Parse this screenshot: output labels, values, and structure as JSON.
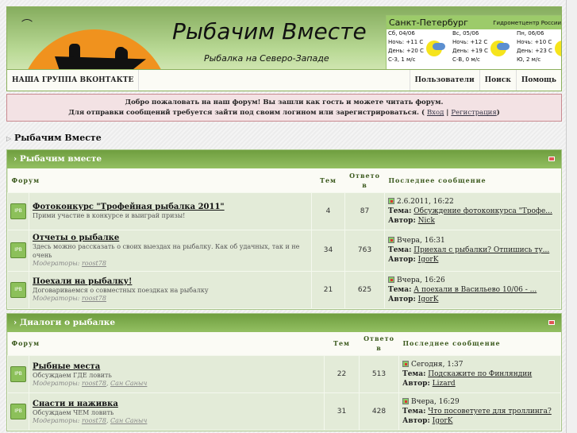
{
  "header": {
    "title": "Рыбачим Вместе",
    "subtitle": "Рыбалка на Северо-Западе"
  },
  "weather": {
    "city": "Санкт-Петербург",
    "source": "Гидрометцентр России",
    "days": [
      {
        "date": "Сб, 04/06",
        "night": "Ночь: +11 С",
        "day": "День: +20 С",
        "wind": "С-З, 1 м/с"
      },
      {
        "date": "Вс, 05/06",
        "night": "Ночь: +12 С",
        "day": "День: +19 С",
        "wind": "С-В, 0 м/с"
      },
      {
        "date": "Пн, 06/06",
        "night": "Ночь: +10 С",
        "day": "День: +23 С",
        "wind": "Ю, 2 м/с"
      }
    ]
  },
  "nav": {
    "vk": "НАША ГРУППА ВКОНТАКТЕ",
    "users": "Пользователи",
    "search": "Поиск",
    "help": "Помощь"
  },
  "welcome": {
    "line1": "Добро пожаловать на наш форум! Вы зашли как гость и можете читать форум.",
    "line2": "Для отправки сообщений требуется зайти под своим логином или зарегистрироваться. (",
    "login": "Вход",
    "register": "Регистрация",
    "close": ")"
  },
  "breadcrumb": "Рыбачим Вместе",
  "cols": {
    "forum": "Форум",
    "topics": "Тем",
    "replies": "Ответов",
    "last": "Последнее сообщение",
    "topic_label": "Тема:",
    "author_label": "Автор:",
    "mods_label": "Модераторы:"
  },
  "categories": [
    {
      "title": "Рыбачим вместе",
      "forums": [
        {
          "name": "Фотоконкурс \"Трофейная рыбалка 2011\"",
          "desc": "Прими участие в конкурсе и выиграй призы!",
          "mods": [],
          "topics": "4",
          "replies": "87",
          "last_date": "2.6.2011, 16:22",
          "last_topic": "Обсуждение фотоконкурса \"Трофе...",
          "last_author": "Nick"
        },
        {
          "name": "Отчеты о рыбалке",
          "desc": "Здесь можно рассказать о своих выездах на рыбалку. Как об удачных, так и не очень",
          "mods": [
            "roost78"
          ],
          "topics": "34",
          "replies": "763",
          "last_date": "Вчера, 16:31",
          "last_topic": "Приехал с рыбалки? Отпишись ту...",
          "last_author": "IgorK"
        },
        {
          "name": "Поехали на рыбалку!",
          "desc": "Договариваемся о совместных поездках на рыбалку",
          "mods": [
            "roost78"
          ],
          "topics": "21",
          "replies": "625",
          "last_date": "Вчера, 16:26",
          "last_topic": "А поехали в Васильево 10/06 - ...",
          "last_author": "IgorK"
        }
      ]
    },
    {
      "title": "Диалоги о рыбалке",
      "forums": [
        {
          "name": "Рыбные места",
          "desc": "Обсуждаем ГДЕ ловить",
          "mods": [
            "roost78",
            "Сан Саныч"
          ],
          "topics": "22",
          "replies": "513",
          "last_date": "Сегодня, 1:37",
          "last_topic": "Подскажите по Финляндии",
          "last_author": "Lizard"
        },
        {
          "name": "Снасти и наживка",
          "desc": "Обсуждаем ЧЕМ ловить",
          "mods": [
            "roost78",
            "Сан Саныч"
          ],
          "topics": "31",
          "replies": "428",
          "last_date": "Вчера, 16:29",
          "last_topic": "Что посоветуете для троллинга?",
          "last_author": "IgorK"
        }
      ]
    }
  ]
}
